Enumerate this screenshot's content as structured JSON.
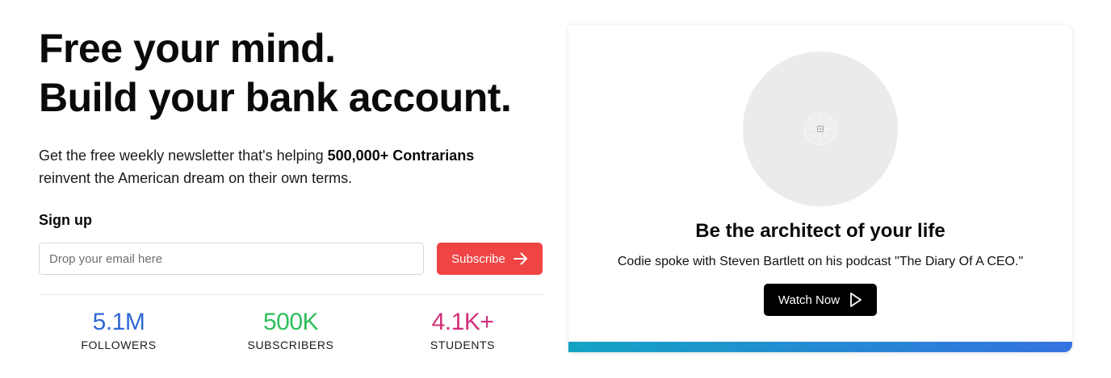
{
  "hero": {
    "headline_line1": "Free your mind.",
    "headline_line2": "Build your bank account.",
    "intro_prefix": "Get the free weekly newsletter that's helping ",
    "intro_bold": "500,000+ Contrarians",
    "intro_suffix": " reinvent the American dream on their own terms."
  },
  "signup": {
    "label": "Sign up",
    "email_placeholder": "Drop your email here",
    "email_value": "",
    "subscribe_label": "Subscribe",
    "subscribe_icon": "arrow-right-icon",
    "button_color": "#ef4444"
  },
  "stats": [
    {
      "value": "5.1M",
      "label": "FOLLOWERS",
      "color": "#3068d6"
    },
    {
      "value": "500K",
      "label": "SUBSCRIBERS",
      "color": "#2fbf5b"
    },
    {
      "value": "4.1K+",
      "label": "STUDENTS",
      "color": "#d0307a"
    }
  ],
  "promo_card": {
    "image_icon": "image-placeholder-icon",
    "title": "Be the architect of your life",
    "subtitle": "Codie spoke with Steven Bartlett on his podcast \"The Diary Of A CEO.\"",
    "watch_label": "Watch Now",
    "watch_icon": "play-icon",
    "bar_gradient": [
      "#14a3c4",
      "#3572e0"
    ]
  }
}
